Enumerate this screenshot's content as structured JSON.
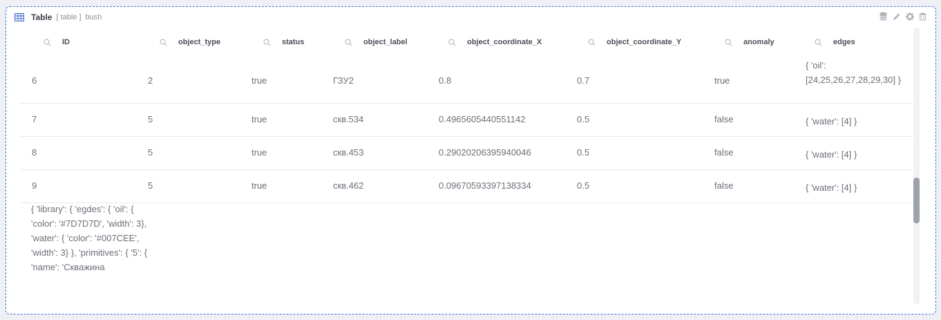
{
  "header": {
    "title": "Table",
    "type_tag": "[ table ]",
    "name": "bush"
  },
  "toolbar": {
    "items": [
      {
        "icon": "database-icon"
      },
      {
        "icon": "pencil-icon"
      },
      {
        "icon": "gear-icon"
      },
      {
        "icon": "trash-icon"
      }
    ]
  },
  "table": {
    "columns": [
      "ID",
      "object_type",
      "status",
      "object_label",
      "object_coordinate_X",
      "object_coordinate_Y",
      "anomaly",
      "edges"
    ],
    "rows": [
      {
        "id": "6",
        "object_type": "2",
        "status": "true",
        "object_label": "ГЗУ2",
        "x": "0.8",
        "y": "0.7",
        "anomaly": "true",
        "edges": "{ 'oil': [24,25,26,27,28,29,30] }"
      },
      {
        "id": "7",
        "object_type": "5",
        "status": "true",
        "object_label": "скв.534",
        "x": "0.4965605440551142",
        "y": "0.5",
        "anomaly": "false",
        "edges": "{ 'water': [4] }"
      },
      {
        "id": "8",
        "object_type": "5",
        "status": "true",
        "object_label": "скв.453",
        "x": "0.29020206395940046",
        "y": "0.5",
        "anomaly": "false",
        "edges": "{ 'water': [4] }"
      },
      {
        "id": "9",
        "object_type": "5",
        "status": "true",
        "object_label": "скв.462",
        "x": "0.09670593397138334",
        "y": "0.5",
        "anomaly": "false",
        "edges": "{ 'water': [4] }"
      }
    ],
    "trailing_text": "{ 'library': { 'egdes': { 'oil': { 'color': '#7D7D7D', 'width': 3}, 'water': { 'color': '#007CEE', 'width': 3} }, 'primitives': { '5': { 'name': 'Скважина"
  },
  "colors": {
    "accent": "#3f6fd1",
    "border": "#e6e8ee",
    "scroll_thumb": "#9ea2ac"
  }
}
